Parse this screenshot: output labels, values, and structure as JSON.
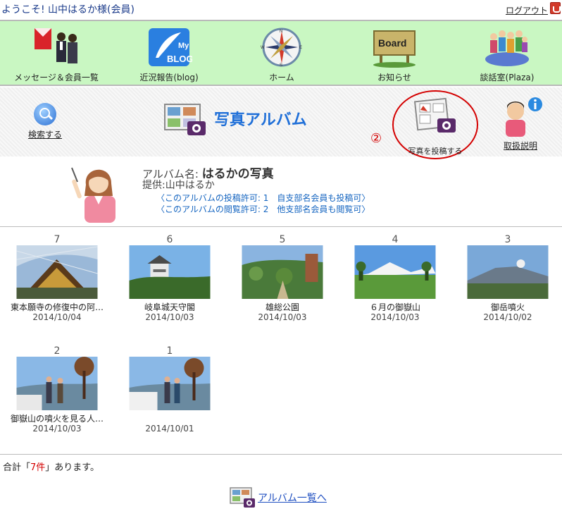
{
  "header": {
    "welcome": "ようこそ! 山中はるか様(会員)",
    "logout_label": "ログアウト"
  },
  "nav": {
    "items": [
      {
        "label": "メッセージ＆会員一覧",
        "icon": "message-people-icon"
      },
      {
        "label": "近況報告(blog)",
        "icon": "blog-icon",
        "icon_text_top": "My",
        "icon_text_bottom": "BLOG"
      },
      {
        "label": "ホーム",
        "icon": "compass-icon",
        "compass": [
          "N",
          "E",
          "S",
          "W"
        ]
      },
      {
        "label": "お知らせ",
        "icon": "board-icon",
        "icon_text": "Board"
      },
      {
        "label": "談話室(Plaza)",
        "icon": "plaza-people-icon"
      }
    ]
  },
  "toolbar": {
    "search_label": "検索する",
    "page_title": "写真アルバム",
    "post_number": "②",
    "post_label": "写真を投稿する",
    "manual_label": "取扱説明"
  },
  "album": {
    "name_prefix": "アルバム名:",
    "name": "はるかの写真",
    "provider": "提供:山中はるか",
    "post_permission": "〈このアルバムの投稿許可: 1　自支部名会員も投稿可〉",
    "view_permission": "〈このアルバムの閲覧許可: 2　他支部名会員も閲覧可〉"
  },
  "photos": [
    {
      "number": "7",
      "caption": "東本願寺の修復中の阿…",
      "date": "2014/10/04",
      "scene": "temple"
    },
    {
      "number": "6",
      "caption": "岐阜城天守閣",
      "date": "2014/10/03",
      "scene": "castle"
    },
    {
      "number": "5",
      "caption": "雄総公園",
      "date": "2014/10/03",
      "scene": "garden"
    },
    {
      "number": "4",
      "caption": "６月の御嶽山",
      "date": "2014/10/03",
      "scene": "mountain-snow"
    },
    {
      "number": "3",
      "caption": "御岳噴火",
      "date": "2014/10/02",
      "scene": "mountain-eruption"
    },
    {
      "number": "2",
      "caption": "御嶽山の噴火を見る人…",
      "date": "2014/10/03",
      "scene": "people-view"
    },
    {
      "number": "1",
      "caption": "",
      "date": "2014/10/01",
      "scene": "people-view2"
    }
  ],
  "summary": {
    "prefix": "合計「",
    "count": "7件",
    "suffix": "」あります。"
  },
  "footer": {
    "back_label": "アルバム一覧へ"
  },
  "colors": {
    "nav_bg": "#c9f7c2",
    "title_blue": "#1f6fd8",
    "link_blue": "#1565c0",
    "accent_red": "#d40000"
  }
}
